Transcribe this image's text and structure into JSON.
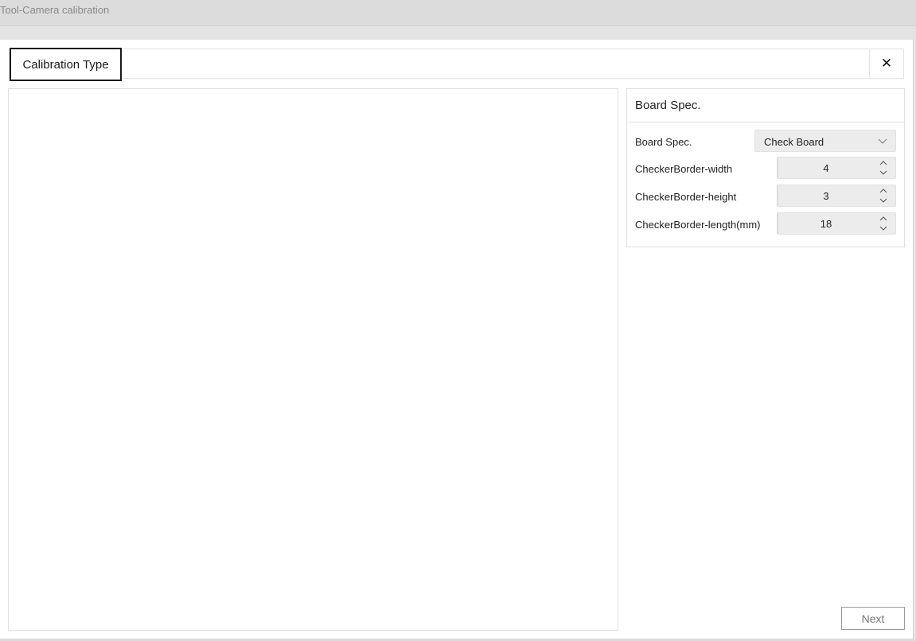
{
  "window": {
    "title": "Tool-Camera calibration"
  },
  "tabs": [
    {
      "label": "Calibration Type",
      "active": true
    }
  ],
  "close_icon": "close-icon",
  "board_spec_panel": {
    "header": "Board Spec.",
    "fields": [
      {
        "label": "Board Spec.",
        "type": "select",
        "value": "Check Board"
      },
      {
        "label": "CheckerBorder-width",
        "type": "spinbox",
        "value": "4"
      },
      {
        "label": "CheckerBorder-height",
        "type": "spinbox",
        "value": "3"
      },
      {
        "label": "CheckerBorder-length(mm)",
        "type": "spinbox",
        "value": "18"
      }
    ]
  },
  "footer": {
    "next_label": "Next",
    "next_enabled": false
  },
  "colors": {
    "accent_border": "#1a1a1a",
    "titlebar_bg": "#dcdcdc",
    "field_bg": "#ececec",
    "disabled_text": "#777777"
  }
}
